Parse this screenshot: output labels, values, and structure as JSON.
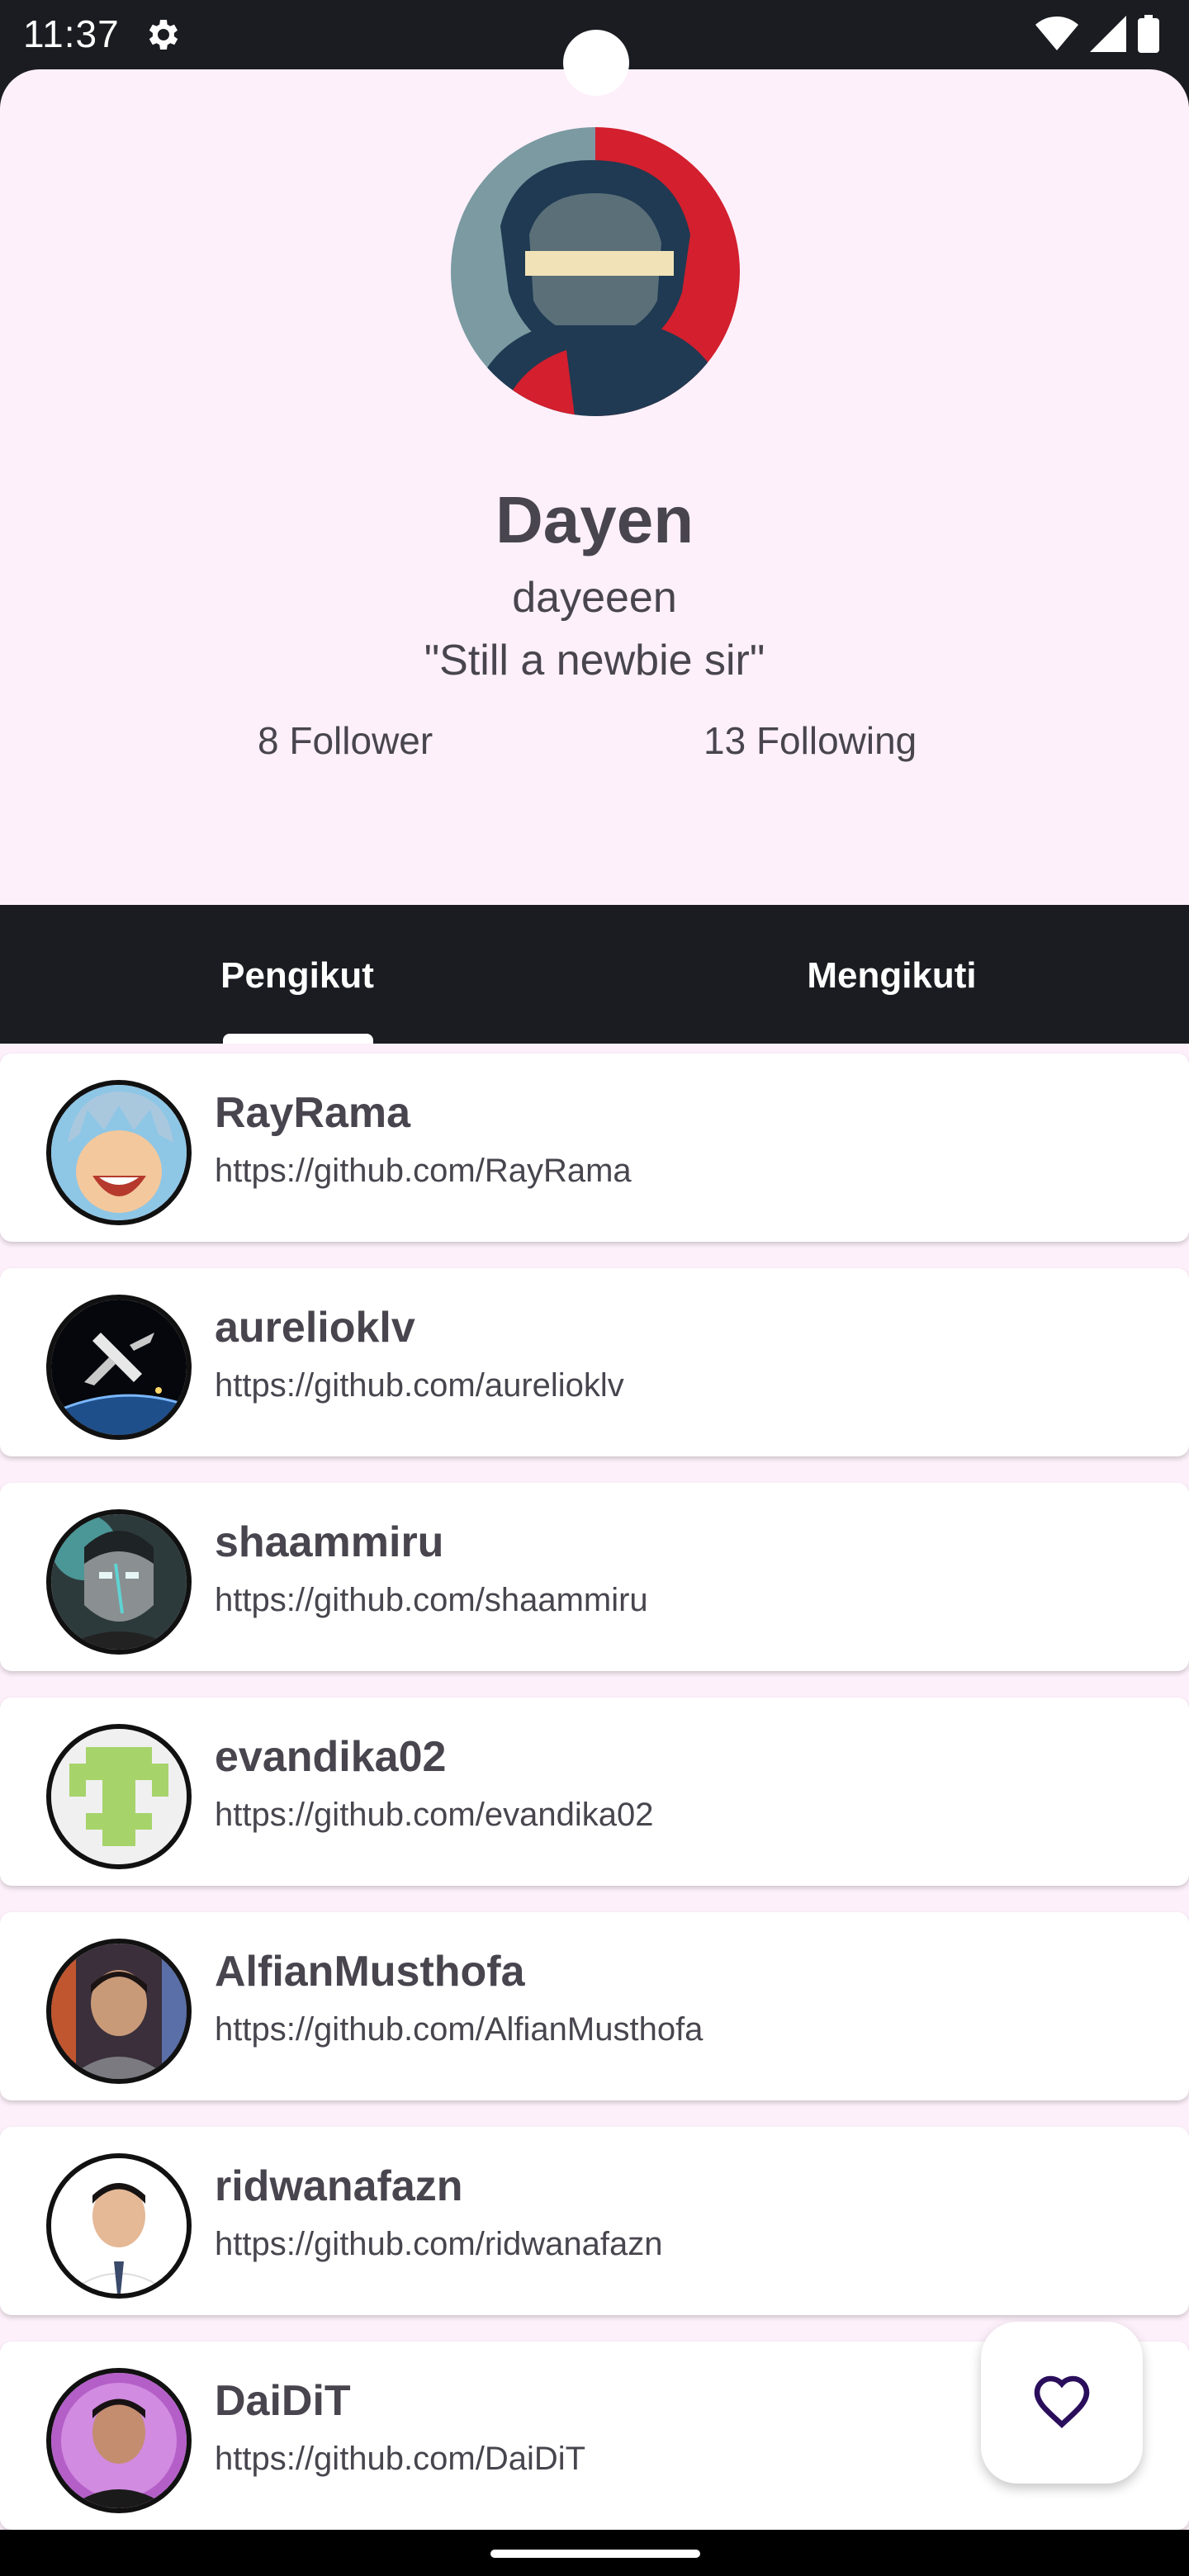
{
  "status_bar": {
    "time": "11:37",
    "icons": [
      "gear-icon",
      "wifi-icon",
      "signal-icon",
      "battery-icon"
    ]
  },
  "profile": {
    "name": "Dayen",
    "login": "dayeeen",
    "bio": "\"Still a newbie sir\"",
    "followers": "8 Follower",
    "following": "13 Following"
  },
  "tabs": [
    {
      "label": "Pengikut",
      "selected": true
    },
    {
      "label": "Mengikuti",
      "selected": false
    }
  ],
  "users": [
    {
      "name": "RayRama",
      "url": "https://github.com/RayRama"
    },
    {
      "name": "aurelioklv",
      "url": "https://github.com/aurelioklv"
    },
    {
      "name": "shaammiru",
      "url": "https://github.com/shaammiru"
    },
    {
      "name": "evandika02",
      "url": "https://github.com/evandika02"
    },
    {
      "name": "AlfianMusthofa",
      "url": "https://github.com/AlfianMusthofa"
    },
    {
      "name": "ridwanafazn",
      "url": "https://github.com/ridwanafazn"
    },
    {
      "name": "DaiDiT",
      "url": "https://github.com/DaiDiT"
    }
  ],
  "fab": {
    "icon": "heart-outline-icon"
  },
  "colors": {
    "header_bg": "#fdf0fa",
    "tab_bg": "#1a1c21",
    "text": "#48454e",
    "accent": "#2a0e5c"
  }
}
